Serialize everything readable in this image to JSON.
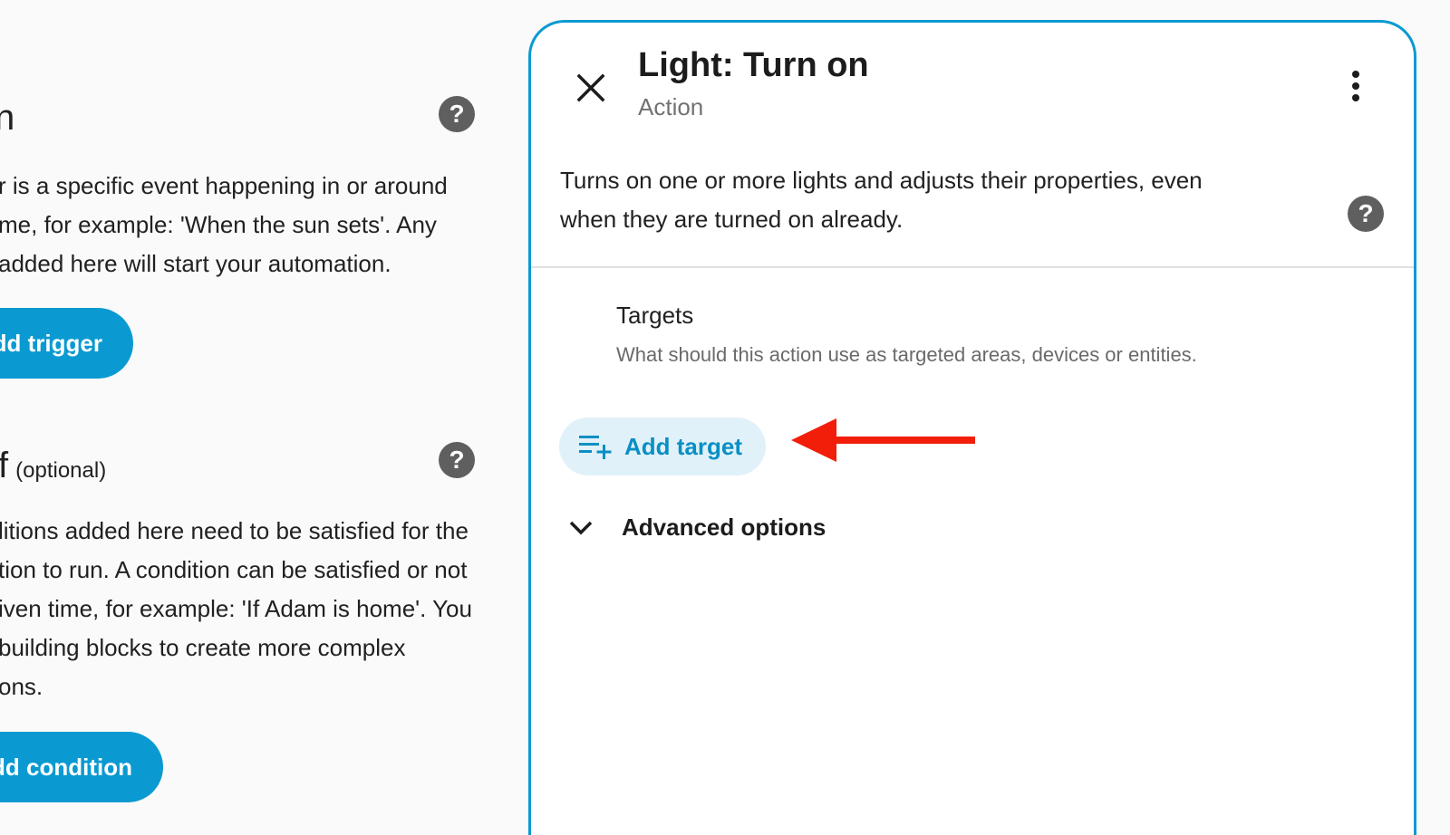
{
  "left_panel": {
    "trigger_section": {
      "heading": "n",
      "description": [
        "r is a specific event happening in or around",
        "me, for example: 'When the sun sets'. Any",
        "added here will start your automation."
      ],
      "button": "dd trigger"
    },
    "condition_section": {
      "heading": "f",
      "optional": "(optional)",
      "description": [
        "litions added here need to be satisfied for the",
        "tion to run. A condition can be satisfied or not",
        "iven time, for example: 'If Adam is home'. You",
        " building blocks to create more complex",
        "ons."
      ],
      "button": "dd condition"
    }
  },
  "dialog": {
    "title": "Light: Turn on",
    "subtitle": "Action",
    "description": [
      "Turns on one or more lights and adjusts their properties, even",
      "when they are turned on already."
    ],
    "targets": {
      "label": "Targets",
      "helper": "What should this action use as targeted areas, devices or entities.",
      "add_button": "Add target"
    },
    "advanced_options": "Advanced options"
  },
  "colors": {
    "accent": "#0a9ad1",
    "add_target_bg": "#e0f1f9",
    "annotation_arrow": "#f21e0a",
    "help_icon": "#5f5f5f"
  },
  "icons": {
    "close": "close-icon",
    "menu": "more-vertical-icon",
    "help": "help-circle-icon",
    "add_target": "playlist-plus-icon",
    "expand": "chevron-down-icon",
    "annotation": "red-arrow-left"
  }
}
